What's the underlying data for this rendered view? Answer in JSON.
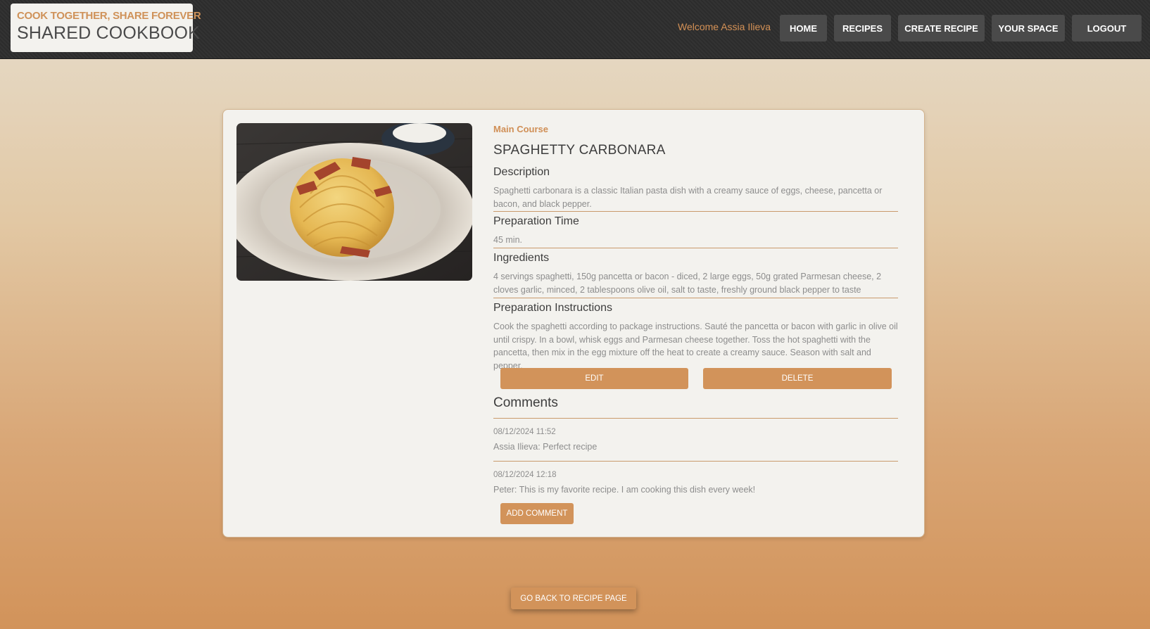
{
  "header": {
    "tagline": "COOK TOGETHER, SHARE FOREVER",
    "title": "SHARED COOKBOOK",
    "welcome": "Welcome Assia Ilieva",
    "nav": [
      "HOME",
      "RECIPES",
      "CREATE RECIPE",
      "YOUR SPACE",
      "LOGOUT"
    ]
  },
  "recipe": {
    "image_icon": "spaghetti-carbonara-photo",
    "category": "Main Course",
    "title": "SPAGHETTY CARBONARA",
    "description_heading": "Description",
    "description": "Spaghetti carbonara is a classic Italian pasta dish with a creamy sauce of eggs, cheese, pancetta or bacon, and black pepper.",
    "prep_time_heading": "Preparation Time",
    "prep_time": "45 min.",
    "ingredients_heading": "Ingredients",
    "ingredients": "4 servings spaghetti, 150g pancetta or bacon - diced, 2 large eggs, 50g grated Parmesan cheese, 2 cloves garlic, minced, 2 tablespoons olive oil, salt to taste, freshly ground black pepper to taste",
    "instructions_heading": "Preparation Instructions",
    "instructions": "Cook the spaghetti according to package instructions. Sauté the pancetta or bacon with garlic in olive oil until crispy. In a bowl, whisk eggs and Parmesan cheese together. Toss the hot spaghetti with the pancetta, then mix in the egg mixture off the heat to create a creamy sauce. Season with salt and pepper.",
    "edit_label": "EDIT",
    "delete_label": "DELETE"
  },
  "comments": {
    "heading": "Comments",
    "items": [
      {
        "date": "08/12/2024 11:52",
        "text": "Assia Ilieva: Perfect recipe"
      },
      {
        "date": "08/12/2024 12:18",
        "text": "Peter: This is my favorite recipe. I am cooking this dish every week!"
      }
    ],
    "add_label": "ADD COMMENT"
  },
  "footer": {
    "back_label": "GO BACK TO RECIPE PAGE"
  },
  "colors": {
    "accent": "#d2935a",
    "header_bg": "#2e2e2e",
    "card_bg": "#f3f2ee",
    "nav_btn_bg": "#4a4a4a"
  }
}
